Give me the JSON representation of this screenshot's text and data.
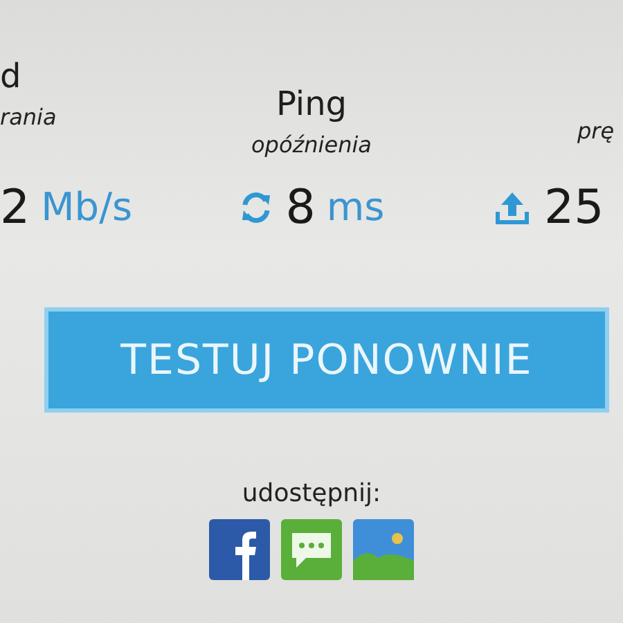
{
  "stats": [
    {
      "kind": "download",
      "title": "d",
      "subtitle": "rania",
      "value": "2",
      "unit": "Mb/s"
    },
    {
      "kind": "ping",
      "title": "Ping",
      "subtitle": "opóźnienia",
      "value": "8",
      "unit": "ms"
    },
    {
      "kind": "upload",
      "subtitle": "prę",
      "value": "25"
    }
  ],
  "retest_button": "TESTUJ PONOWNIE",
  "share": {
    "label": "udostępnij:",
    "buttons": [
      {
        "kind": "facebook"
      },
      {
        "kind": "message"
      },
      {
        "kind": "image"
      }
    ]
  }
}
